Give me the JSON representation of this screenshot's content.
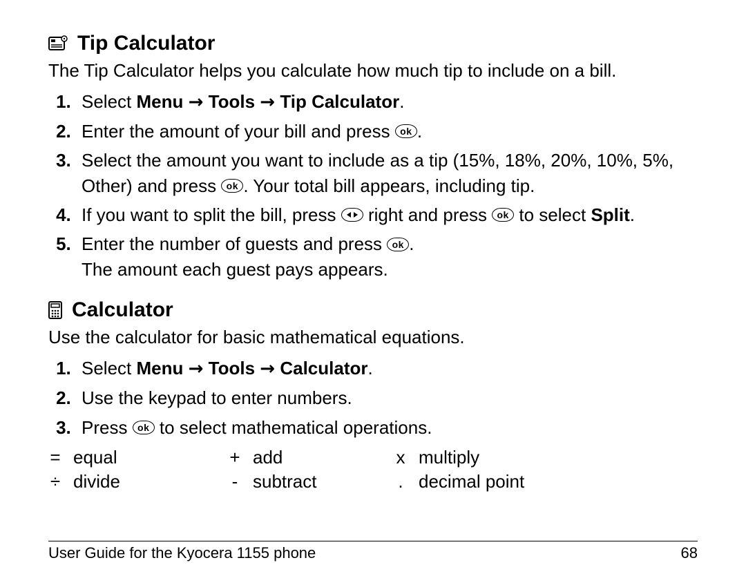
{
  "tip": {
    "heading": "Tip Calculator",
    "intro": "The Tip Calculator helps you calculate how much tip to include on a bill.",
    "steps": {
      "s1_a": "Select ",
      "s1_b": "Menu",
      "s1_c": "Tools",
      "s1_d": "Tip Calculator",
      "s2_a": "Enter the amount of your bill and press ",
      "s3_a": "Select the amount you want to include as a tip (15%, 18%, 20%, 10%, 5%, Other) and press ",
      "s3_b": ". Your total bill appears, including tip.",
      "s4_a": "If you want to split the bill, press ",
      "s4_b": " right and press ",
      "s4_c": " to select ",
      "s4_d": "Split",
      "s5_a": "Enter the number of guests and press ",
      "s5_b": "The amount each guest pays appears."
    }
  },
  "calc": {
    "heading": "Calculator",
    "intro": "Use the calculator for basic mathematical equations.",
    "steps": {
      "s1_a": "Select ",
      "s1_b": "Menu",
      "s1_c": "Tools",
      "s1_d": "Calculator",
      "s2": "Use the keypad to enter numbers.",
      "s3_a": "Press ",
      "s3_b": " to select mathematical operations."
    },
    "ops": {
      "eq_sym": "=",
      "eq_label": "equal",
      "add_sym": "+",
      "add_label": "add",
      "mul_sym": "x",
      "mul_label": "multiply",
      "div_sym": "÷",
      "div_label": "divide",
      "sub_sym": "-",
      "sub_label": "subtract",
      "dec_sym": ".",
      "dec_label": "decimal point"
    }
  },
  "ok_label": "ok",
  "arrow": "→",
  "period": ".",
  "footer": {
    "left": "User Guide for the Kyocera 1155 phone",
    "right": "68"
  }
}
